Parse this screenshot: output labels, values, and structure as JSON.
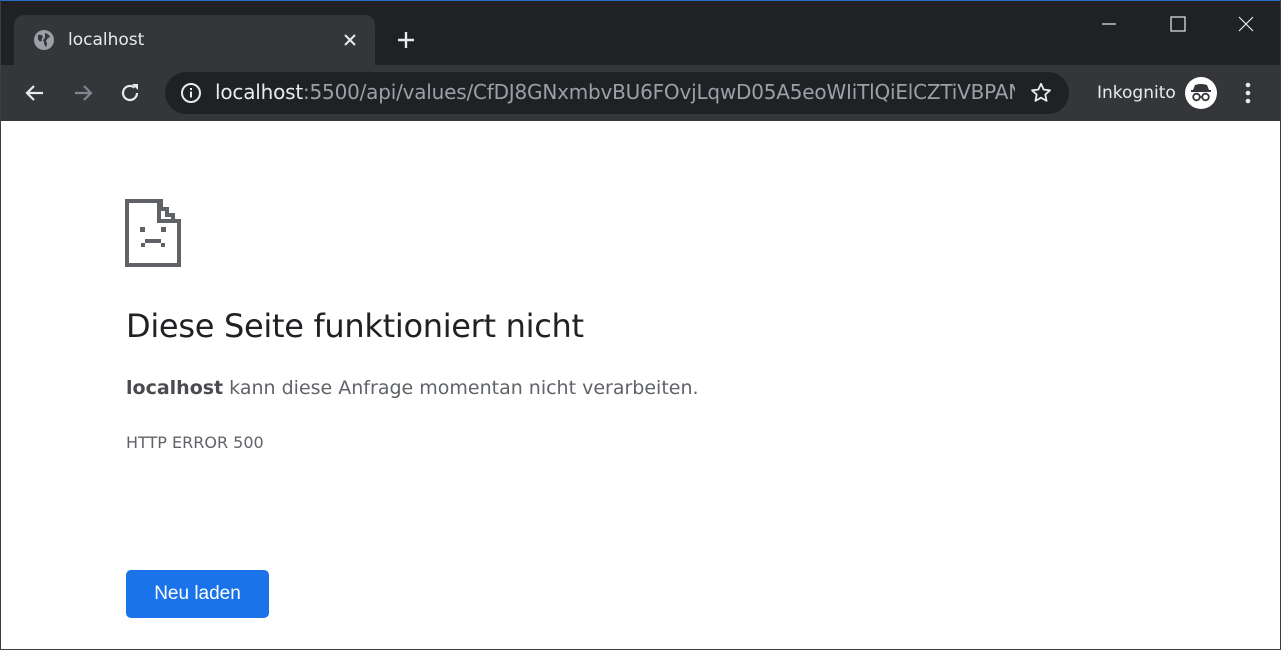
{
  "tab": {
    "title": "localhost"
  },
  "omnibox": {
    "host": "localhost",
    "path": ":5500/api/values/CfDJ8GNxmbvBU6FOvjLqwD05A5eoWIiTlQiElCZTiVBPANI..."
  },
  "profile": {
    "label": "Inkognito"
  },
  "error": {
    "title": "Diese Seite funktioniert nicht",
    "host": "localhost",
    "message": " kann diese Anfrage momentan nicht verarbeiten.",
    "code": "HTTP ERROR 500",
    "reload_label": "Neu laden"
  },
  "colors": {
    "tabstrip": "#202124",
    "toolbar": "#35363a",
    "accent": "#1a73e8"
  },
  "icons": [
    "globe-icon",
    "close-icon",
    "plus-icon",
    "minimize-icon",
    "maximize-icon",
    "window-close-icon",
    "back-icon",
    "forward-icon",
    "reload-icon",
    "info-icon",
    "star-icon",
    "incognito-icon",
    "menu-icon",
    "sad-page-icon"
  ]
}
